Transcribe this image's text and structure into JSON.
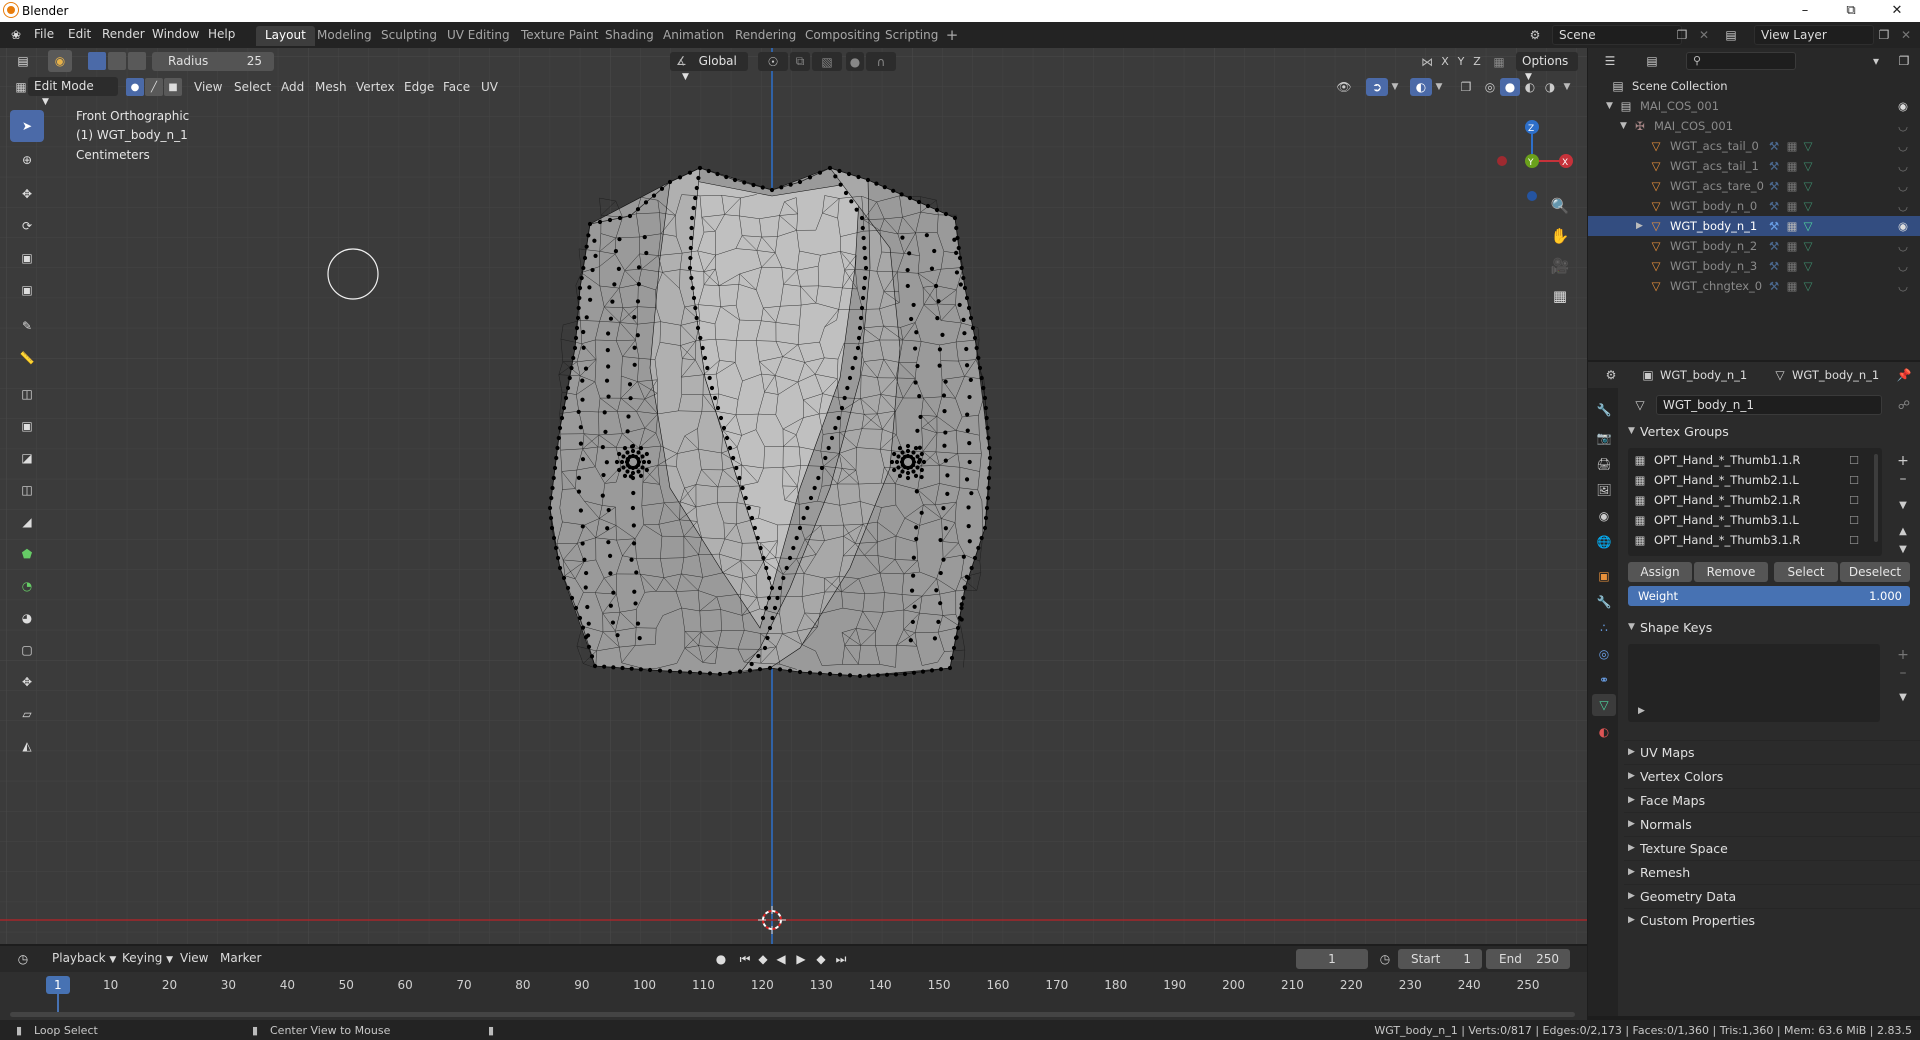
{
  "titlebar": {
    "title": "Blender"
  },
  "menu": [
    "File",
    "Edit",
    "Render",
    "Window",
    "Help"
  ],
  "workspaces": [
    "Layout",
    "Modeling",
    "Sculpting",
    "UV Editing",
    "Texture Paint",
    "Shading",
    "Animation",
    "Rendering",
    "Compositing",
    "Scripting"
  ],
  "active_workspace": "Layout",
  "scene": {
    "name": "Scene",
    "view_layer": "View Layer"
  },
  "tool_header": {
    "radius_label": "Radius",
    "radius_value": "25",
    "orientation": "Global",
    "axes": [
      "X",
      "Y",
      "Z"
    ],
    "options_label": "Options"
  },
  "view_header": {
    "mode": "Edit Mode",
    "menus": [
      "View",
      "Select",
      "Add",
      "Mesh",
      "Vertex",
      "Edge",
      "Face",
      "UV"
    ]
  },
  "viewport_overlay": {
    "view_name": "Front Orthographic",
    "object_name": "(1) WGT_body_n_1",
    "units": "Centimeters"
  },
  "gizmo_axes": [
    "Z",
    "Y",
    "X"
  ],
  "outliner": {
    "collection": "Scene Collection",
    "items": [
      {
        "name": "MAI_COS_001",
        "level": 1,
        "selected": false,
        "visible": true
      },
      {
        "name": "MAI_COS_001",
        "level": 2,
        "selected": false,
        "visible": false
      },
      {
        "name": "WGT_acs_tail_0",
        "level": 3,
        "selected": false,
        "visible": false
      },
      {
        "name": "WGT_acs_tail_1",
        "level": 3,
        "selected": false,
        "visible": false
      },
      {
        "name": "WGT_acs_tare_0",
        "level": 3,
        "selected": false,
        "visible": false
      },
      {
        "name": "WGT_body_n_0",
        "level": 3,
        "selected": false,
        "visible": false
      },
      {
        "name": "WGT_body_n_1",
        "level": 3,
        "selected": true,
        "visible": true
      },
      {
        "name": "WGT_body_n_2",
        "level": 3,
        "selected": false,
        "visible": false
      },
      {
        "name": "WGT_body_n_3",
        "level": 3,
        "selected": false,
        "visible": false
      },
      {
        "name": "WGT_chngtex_0",
        "level": 3,
        "selected": false,
        "visible": false
      }
    ]
  },
  "properties": {
    "object_name": "WGT_body_n_1",
    "mesh_name": "WGT_body_n_1",
    "data_name": "WGT_body_n_1",
    "vertex_groups_title": "Vertex Groups",
    "vertex_groups": [
      "OPT_Hand_*_Thumb1.1.R",
      "OPT_Hand_*_Thumb2.1.L",
      "OPT_Hand_*_Thumb2.1.R",
      "OPT_Hand_*_Thumb3.1.L",
      "OPT_Hand_*_Thumb3.1.R"
    ],
    "vg_buttons": [
      "Assign",
      "Remove",
      "Select",
      "Deselect"
    ],
    "weight_label": "Weight",
    "weight_value": "1.000",
    "shape_keys_title": "Shape Keys",
    "collapsed_panels": [
      "UV Maps",
      "Vertex Colors",
      "Face Maps",
      "Normals",
      "Texture Space",
      "Remesh",
      "Geometry Data",
      "Custom Properties"
    ]
  },
  "timeline": {
    "menus": [
      "Playback",
      "Keying",
      "View",
      "Marker"
    ],
    "current_frame": "1",
    "start_label": "Start",
    "start": "1",
    "end_label": "End",
    "end": "250",
    "ticks": [
      "1",
      "10",
      "20",
      "30",
      "40",
      "50",
      "60",
      "70",
      "80",
      "90",
      "100",
      "110",
      "120",
      "130",
      "140",
      "150",
      "160",
      "170",
      "180",
      "190",
      "200",
      "210",
      "220",
      "230",
      "240",
      "250"
    ]
  },
  "statusbar": {
    "left1": "Loop Select",
    "left2": "Center View to Mouse",
    "right": "WGT_body_n_1 | Verts:0/817 | Edges:0/2,173 | Faces:0/1,360 | Tris:1,360 | Mem: 63.6 MiB | 2.83.5"
  }
}
